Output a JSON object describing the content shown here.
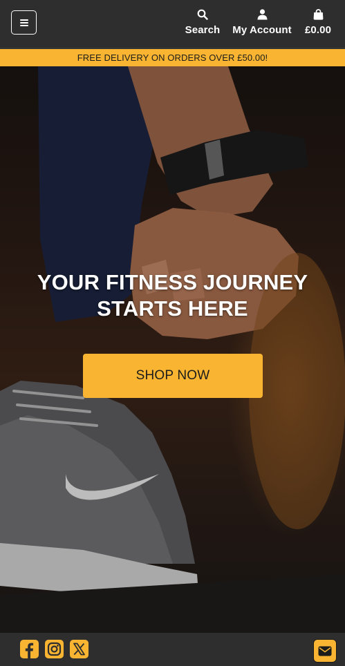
{
  "header": {
    "menu_icon": "hamburger-icon",
    "nav": {
      "search": {
        "label": "Search",
        "icon": "search-icon"
      },
      "account": {
        "label": "My Account",
        "icon": "user-icon"
      },
      "cart": {
        "label": "£0.00",
        "icon": "shopping-bag-icon"
      }
    }
  },
  "banner": {
    "text": "FREE DELIVERY ON ORDERS OVER £50.00!"
  },
  "hero": {
    "title_line1": "YOUR FITNESS JOURNEY",
    "title_line2": "STARTS HERE",
    "cta_label": "SHOP NOW"
  },
  "footer": {
    "social": [
      "facebook-icon",
      "instagram-icon",
      "x-icon"
    ],
    "mail_icon": "envelope-icon"
  },
  "colors": {
    "accent": "#f9b531",
    "header_bg": "#2e2e2e",
    "text_dark": "#1b1b1b",
    "text_light": "#ffffff"
  }
}
